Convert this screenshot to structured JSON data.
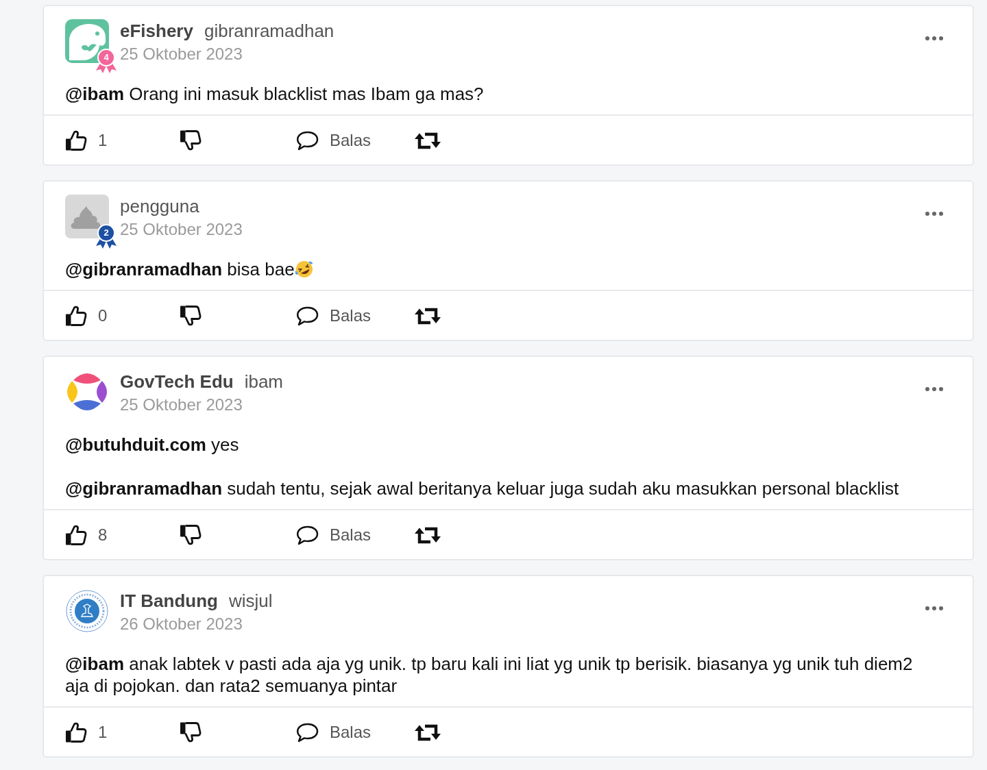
{
  "posts": [
    {
      "avatar": {
        "kind": "fish"
      },
      "badge": {
        "number": "4",
        "color": "#f2669a"
      },
      "organization": "eFishery",
      "username": "gibranramadhan",
      "date": "25 Oktober 2023",
      "paragraphs": [
        {
          "text": "**@ibam** Orang ini masuk blacklist mas Ibam ga mas?"
        }
      ],
      "actions": [
        {
          "kind": "like",
          "count": "1"
        },
        {
          "kind": "dislike"
        },
        {
          "kind": "reply",
          "label": "Balas"
        },
        {
          "kind": "repost"
        }
      ]
    },
    {
      "avatar": {
        "kind": "placeholder"
      },
      "badge": {
        "number": "2",
        "color": "#1d4fa3"
      },
      "username": "pengguna",
      "date": "25 Oktober 2023",
      "paragraphs": [
        {
          "text": "**@gibranramadhan** bisa bae",
          "emoji": true
        }
      ],
      "actions": [
        {
          "kind": "like",
          "count": "0"
        },
        {
          "kind": "dislike"
        },
        {
          "kind": "reply",
          "label": "Balas"
        },
        {
          "kind": "repost"
        }
      ]
    },
    {
      "avatar": {
        "kind": "petals"
      },
      "organization": "GovTech Edu",
      "username": "ibam",
      "date": "25 Oktober 2023",
      "paragraphs": [
        {
          "text": "**@butuhduit.com** yes"
        },
        {
          "text": "**@gibranramadhan** sudah tentu, sejak awal beritanya keluar juga sudah aku masukkan personal blacklist"
        }
      ],
      "actions": [
        {
          "kind": "like",
          "count": "8"
        },
        {
          "kind": "dislike"
        },
        {
          "kind": "reply",
          "label": "Balas"
        },
        {
          "kind": "repost"
        }
      ]
    },
    {
      "avatar": {
        "kind": "seal"
      },
      "organization": "IT Bandung",
      "username": "wisjul",
      "date": "26 Oktober 2023",
      "paragraphs": [
        {
          "text": "**@ibam** anak labtek v pasti ada aja yg unik. tp baru kali ini liat yg unik tp berisik. biasanya yg unik tuh diem2 aja di pojokan. dan rata2 semuanya pintar"
        }
      ],
      "actions": [
        {
          "kind": "like",
          "count": "1"
        },
        {
          "kind": "dislike"
        },
        {
          "kind": "reply",
          "label": "Balas"
        },
        {
          "kind": "repost"
        }
      ]
    }
  ]
}
